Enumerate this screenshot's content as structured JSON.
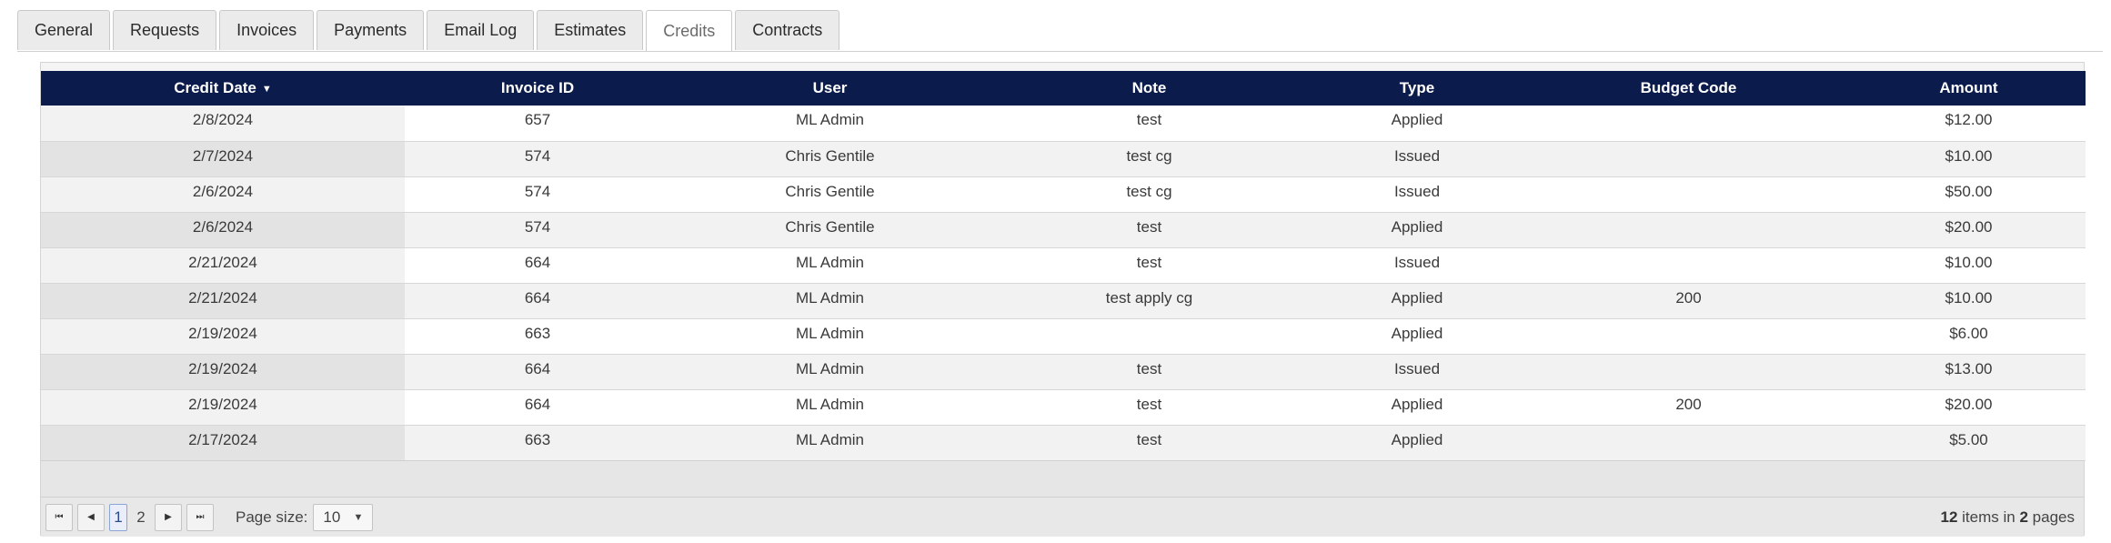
{
  "tabs": [
    {
      "label": "General",
      "active": false
    },
    {
      "label": "Requests",
      "active": false
    },
    {
      "label": "Invoices",
      "active": false
    },
    {
      "label": "Payments",
      "active": false
    },
    {
      "label": "Email Log",
      "active": false
    },
    {
      "label": "Estimates",
      "active": false
    },
    {
      "label": "Credits",
      "active": true
    },
    {
      "label": "Contracts",
      "active": false
    }
  ],
  "grid": {
    "columns": [
      "Credit Date",
      "Invoice ID",
      "User",
      "Note",
      "Type",
      "Budget Code",
      "Amount"
    ],
    "sort_indicator": "▼",
    "rows": [
      [
        "2/8/2024",
        "657",
        "ML Admin",
        "test",
        "Applied",
        "",
        "$12.00"
      ],
      [
        "2/7/2024",
        "574",
        "Chris Gentile",
        "test cg",
        "Issued",
        "",
        "$10.00"
      ],
      [
        "2/6/2024",
        "574",
        "Chris Gentile",
        "test cg",
        "Issued",
        "",
        "$50.00"
      ],
      [
        "2/6/2024",
        "574",
        "Chris Gentile",
        "test",
        "Applied",
        "",
        "$20.00"
      ],
      [
        "2/21/2024",
        "664",
        "ML Admin",
        "test",
        "Issued",
        "",
        "$10.00"
      ],
      [
        "2/21/2024",
        "664",
        "ML Admin",
        "test apply cg",
        "Applied",
        "200",
        "$10.00"
      ],
      [
        "2/19/2024",
        "663",
        "ML Admin",
        "",
        "Applied",
        "",
        "$6.00"
      ],
      [
        "2/19/2024",
        "664",
        "ML Admin",
        "test",
        "Issued",
        "",
        "$13.00"
      ],
      [
        "2/19/2024",
        "664",
        "ML Admin",
        "test",
        "Applied",
        "200",
        "$20.00"
      ],
      [
        "2/17/2024",
        "663",
        "ML Admin",
        "test",
        "Applied",
        "",
        "$5.00"
      ]
    ]
  },
  "pager": {
    "pages": [
      "1",
      "2"
    ],
    "current_page": "1",
    "page_size_label": "Page size:",
    "page_size": "10",
    "total_items": "12",
    "items_in_text": "items in",
    "total_pages": "2",
    "pages_text": "pages"
  },
  "colors": {
    "header_bg": "#0b1c4c",
    "header_text": "#ffffff",
    "row_alt": "#f2f2f2",
    "sorted_col": "#e3e3e3"
  }
}
